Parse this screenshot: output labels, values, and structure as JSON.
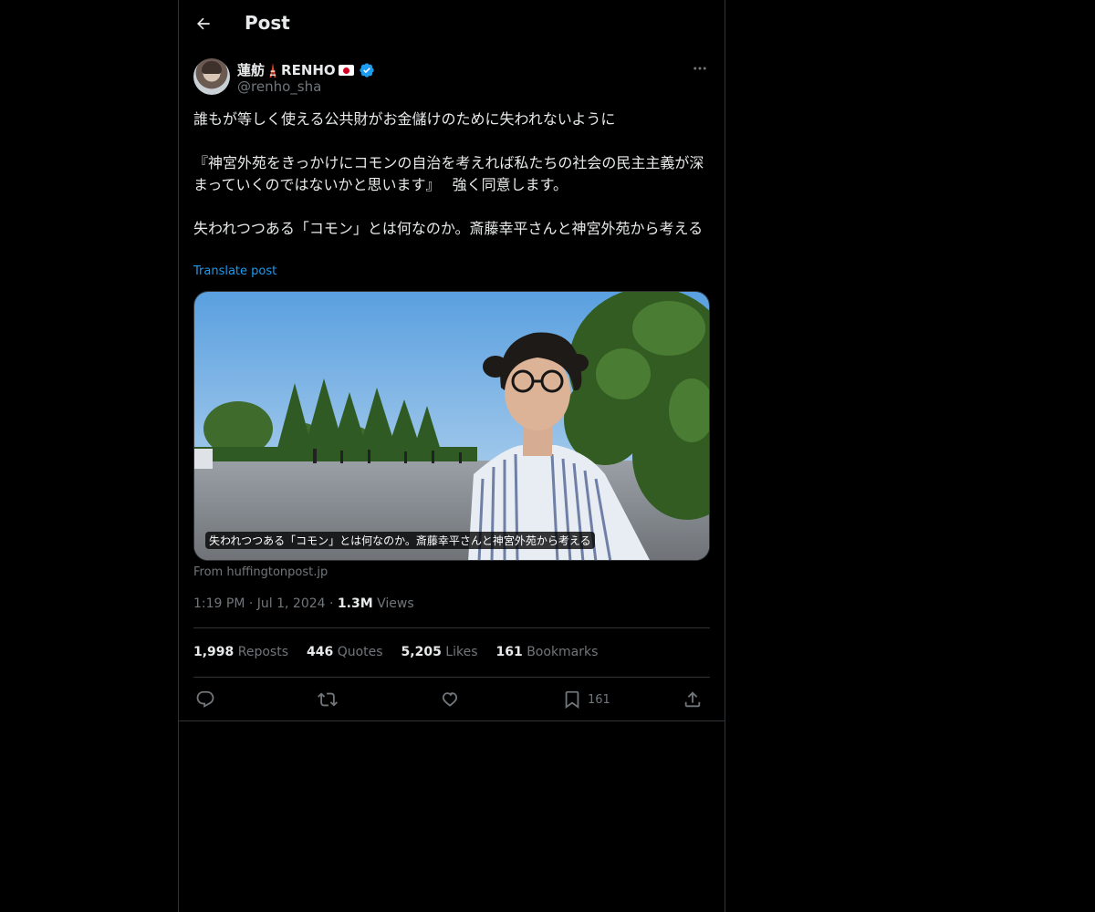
{
  "header": {
    "title": "Post",
    "back_icon": "arrow-left-icon"
  },
  "author": {
    "name": "蓮舫",
    "name_suffix": "RENHO",
    "handle": "@renho_sha",
    "name_icons": [
      "tokyo-tower-icon",
      "japan-flag-icon",
      "verified-badge-icon"
    ],
    "more_icon": "more-dots-icon"
  },
  "tweet": {
    "line1": "誰もが等しく使える公共財がお金儲けのために失われないように",
    "line2": "『神宮外苑をきっかけにコモンの自治を考えれば私たちの社会の民主主義が深まっていくのではないかと思います』　 強く同意します。",
    "line3": "失われつつある「コモン」とは何なのか。斎藤幸平さんと神宮外苑から考える",
    "translate_label": "Translate post"
  },
  "media": {
    "caption": "失われつつある「コモン」とは何なのか。斎藤幸平さんと神宮外苑から考える",
    "source": "From huffingtonpost.jp"
  },
  "meta": {
    "time": "1:19 PM",
    "separator": "·",
    "date": "Jul 1, 2024",
    "views_count": "1.3M",
    "views_label": "Views"
  },
  "stats": {
    "reposts_count": "1,998",
    "reposts_label": "Reposts",
    "quotes_count": "446",
    "quotes_label": "Quotes",
    "likes_count": "5,205",
    "likes_label": "Likes",
    "bookmarks_count": "161",
    "bookmarks_label": "Bookmarks"
  },
  "actions": {
    "reply_icon": "reply-icon",
    "repost_icon": "repost-icon",
    "like_icon": "heart-icon",
    "bookmark_icon": "bookmark-icon",
    "bookmark_count": "161",
    "share_icon": "share-icon"
  },
  "colors": {
    "background": "#000000",
    "text": "#e7e9ea",
    "secondary_text": "#71767b",
    "accent": "#1d9bf0",
    "border": "#2f3336"
  }
}
